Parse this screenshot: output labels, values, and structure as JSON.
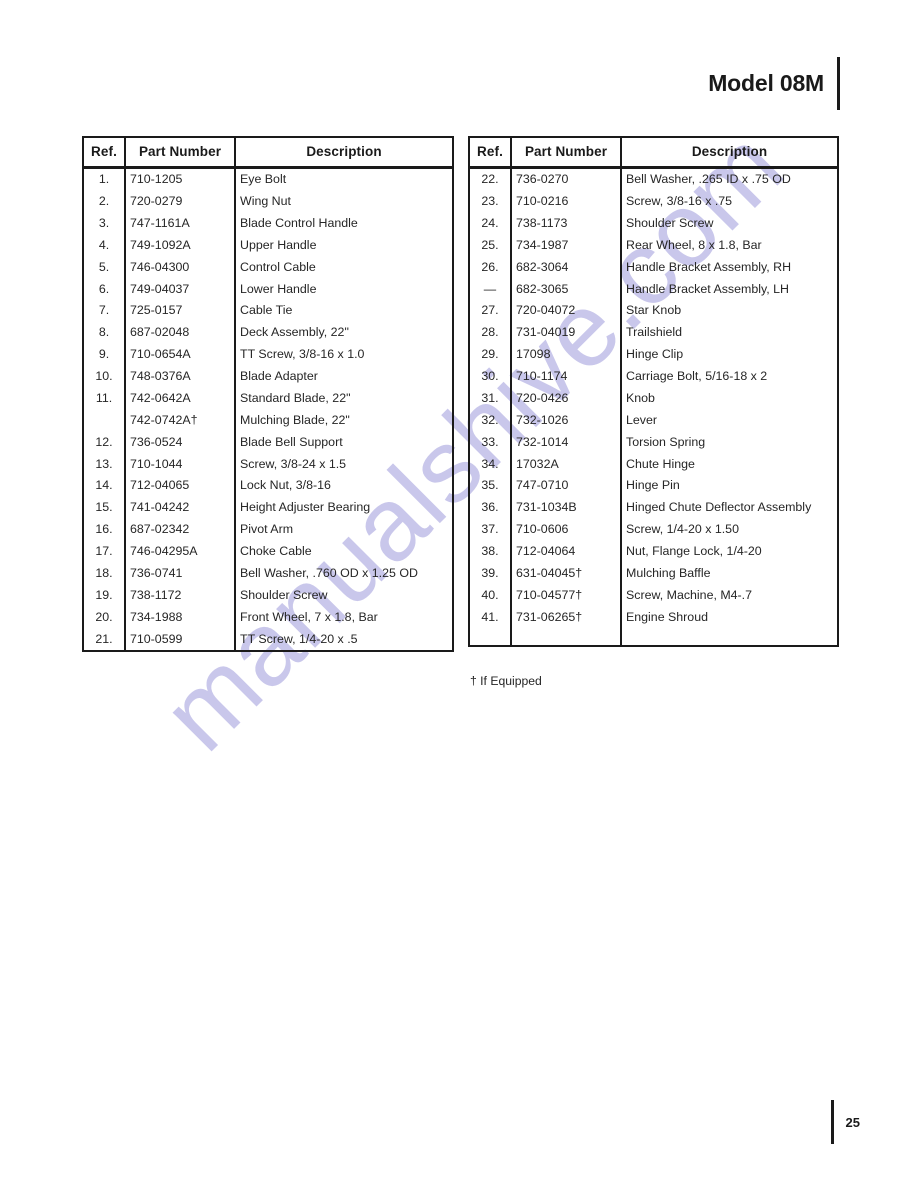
{
  "header": {
    "model_title": "Model 08M"
  },
  "watermark": {
    "text": "manualshive.com",
    "color": "#c7c5ea"
  },
  "columns": {
    "ref": "Ref.",
    "part_number": "Part Number",
    "description": "Description"
  },
  "tables": [
    {
      "id": "left",
      "rows": [
        {
          "ref": "1.",
          "part": "710-1205",
          "desc": "Eye Bolt"
        },
        {
          "ref": "2.",
          "part": "720-0279",
          "desc": "Wing Nut"
        },
        {
          "ref": "3.",
          "part": "747-1161A",
          "desc": "Blade Control Handle"
        },
        {
          "ref": "4.",
          "part": "749-1092A",
          "desc": "Upper Handle"
        },
        {
          "ref": "5.",
          "part": "746-04300",
          "desc": "Control Cable"
        },
        {
          "ref": "6.",
          "part": "749-04037",
          "desc": "Lower Handle"
        },
        {
          "ref": "7.",
          "part": "725-0157",
          "desc": "Cable Tie"
        },
        {
          "ref": "8.",
          "part": "687-02048",
          "desc": "Deck Assembly, 22\""
        },
        {
          "ref": "9.",
          "part": "710-0654A",
          "desc": "TT Screw, 3/8-16 x 1.0"
        },
        {
          "ref": "10.",
          "part": "748-0376A",
          "desc": "Blade Adapter"
        },
        {
          "ref": "11.",
          "part": "742-0642A",
          "desc": "Standard Blade, 22\""
        },
        {
          "ref": "",
          "part": "742-0742A†",
          "desc": "Mulching Blade, 22\""
        },
        {
          "ref": "12.",
          "part": "736-0524",
          "desc": "Blade Bell Support"
        },
        {
          "ref": "13.",
          "part": "710-1044",
          "desc": "Screw, 3/8-24 x 1.5"
        },
        {
          "ref": "14.",
          "part": "712-04065",
          "desc": "Lock Nut, 3/8-16"
        },
        {
          "ref": "15.",
          "part": "741-04242",
          "desc": "Height Adjuster Bearing"
        },
        {
          "ref": "16.",
          "part": "687-02342",
          "desc": "Pivot Arm"
        },
        {
          "ref": "17.",
          "part": "746-04295A",
          "desc": "Choke Cable"
        },
        {
          "ref": "18.",
          "part": "736-0741",
          "desc": "Bell Washer, .760 OD x 1.25 OD"
        },
        {
          "ref": "19.",
          "part": "738-1172",
          "desc": "Shoulder Screw"
        },
        {
          "ref": "20.",
          "part": "734-1988",
          "desc": "Front Wheel, 7 x 1.8, Bar"
        },
        {
          "ref": "21.",
          "part": "710-0599",
          "desc": "TT Screw, 1/4-20 x .5"
        }
      ],
      "filler_rows": 0
    },
    {
      "id": "right",
      "rows": [
        {
          "ref": "22.",
          "part": "736-0270",
          "desc": "Bell Washer, .265 ID x .75 OD"
        },
        {
          "ref": "23.",
          "part": "710-0216",
          "desc": "Screw, 3/8-16 x .75"
        },
        {
          "ref": "24.",
          "part": "738-1173",
          "desc": "Shoulder Screw"
        },
        {
          "ref": "25.",
          "part": "734-1987",
          "desc": "Rear Wheel, 8 x 1.8, Bar"
        },
        {
          "ref": "26.",
          "part": "682-3064",
          "desc": "Handle Bracket Assembly, RH"
        },
        {
          "ref": "—",
          "part": "682-3065",
          "desc": "Handle Bracket Assembly, LH"
        },
        {
          "ref": "27.",
          "part": "720-04072",
          "desc": "Star Knob"
        },
        {
          "ref": "28.",
          "part": "731-04019",
          "desc": "Trailshield"
        },
        {
          "ref": "29.",
          "part": "17098",
          "desc": "Hinge Clip"
        },
        {
          "ref": "30.",
          "part": "710-1174",
          "desc": "Carriage Bolt, 5/16-18 x 2"
        },
        {
          "ref": "31.",
          "part": "720-0426",
          "desc": "Knob"
        },
        {
          "ref": "32.",
          "part": "732-1026",
          "desc": "Lever"
        },
        {
          "ref": "33.",
          "part": "732-1014",
          "desc": "Torsion Spring"
        },
        {
          "ref": "34.",
          "part": "17032A",
          "desc": "Chute Hinge"
        },
        {
          "ref": "35.",
          "part": "747-0710",
          "desc": "Hinge Pin"
        },
        {
          "ref": "36.",
          "part": "731-1034B",
          "desc": "Hinged Chute Deflector Assembly"
        },
        {
          "ref": "37.",
          "part": "710-0606",
          "desc": "Screw, 1/4-20 x 1.50"
        },
        {
          "ref": "38.",
          "part": "712-04064",
          "desc": "Nut, Flange Lock, 1/4-20"
        },
        {
          "ref": "39.",
          "part": "631-04045†",
          "desc": "Mulching Baffle"
        },
        {
          "ref": "40.",
          "part": "710-04577†",
          "desc": "Screw, Machine, M4-.7"
        },
        {
          "ref": "41.",
          "part": "731-06265†",
          "desc": "Engine Shroud"
        }
      ],
      "filler_rows": 1
    }
  ],
  "footnote": "† If Equipped",
  "footer": {
    "page_number": "25"
  }
}
